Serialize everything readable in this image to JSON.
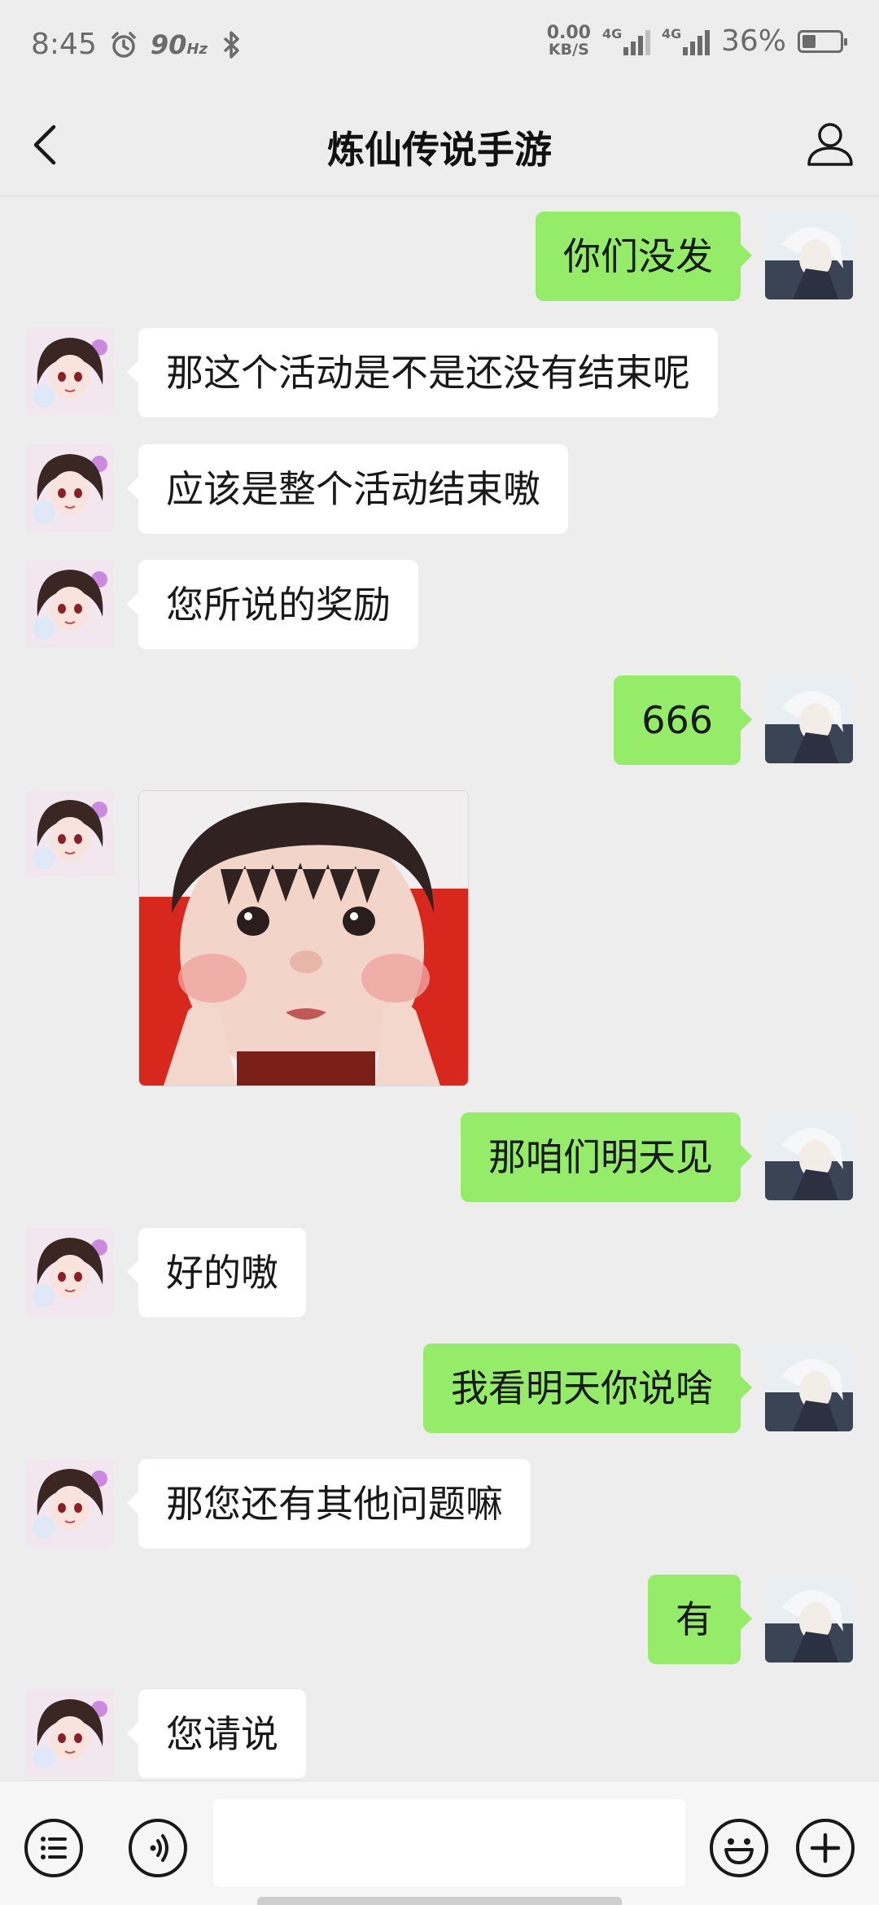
{
  "status_bar": {
    "time": "8:45",
    "refresh_rate": "90",
    "refresh_unit": "Hz",
    "net_speed_value": "0.00",
    "net_speed_unit": "KB/S",
    "sim1_label": "4G",
    "sim2_label": "4G",
    "battery_percent": "36%",
    "battery_level": 0.36
  },
  "header": {
    "title": "炼仙传说手游",
    "back_icon": "chevron-left-icon",
    "profile_icon": "person-icon"
  },
  "messages": [
    {
      "side": "right",
      "text": "你们没发"
    },
    {
      "side": "left",
      "text": "那这个活动是不是还没有结束呢"
    },
    {
      "side": "left",
      "text": "应该是整个活动结束嗷"
    },
    {
      "side": "left",
      "text": "您所说的奖励"
    },
    {
      "side": "right",
      "text": "666"
    },
    {
      "side": "left",
      "type": "image",
      "image": "baby-face-sticker"
    },
    {
      "side": "right",
      "text": "那咱们明天见"
    },
    {
      "side": "left",
      "text": "好的嗷"
    },
    {
      "side": "right",
      "text": "我看明天你说啥"
    },
    {
      "side": "left",
      "text": "那您还有其他问题嘛"
    },
    {
      "side": "right",
      "text": "有"
    },
    {
      "side": "left",
      "text": "您请说"
    }
  ],
  "input_bar": {
    "menu_icon": "list-icon",
    "voice_icon": "voice-icon",
    "input_value": "",
    "emoji_icon": "smiley-icon",
    "plus_icon": "plus-icon"
  },
  "colors": {
    "background": "#ededed",
    "own_bubble": "#95ec69",
    "other_bubble": "#ffffff"
  }
}
